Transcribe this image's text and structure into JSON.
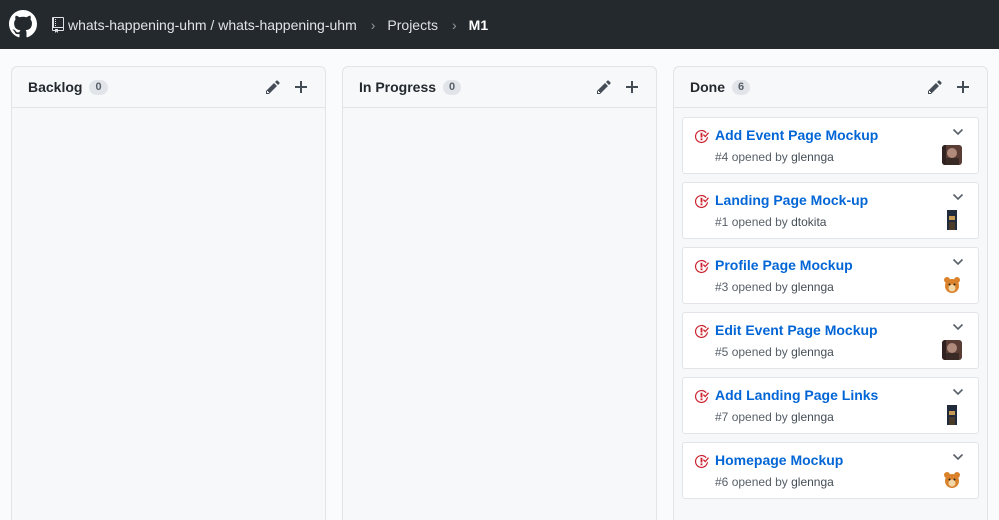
{
  "header": {
    "owner": "whats-happening-uhm",
    "separator": " / ",
    "repo": "whats-happening-uhm",
    "projects_label": "Projects",
    "project_name": "M1"
  },
  "columns": [
    {
      "name": "Backlog",
      "count": "0",
      "cards": []
    },
    {
      "name": "In Progress",
      "count": "0",
      "cards": []
    },
    {
      "name": "Done",
      "count": "6",
      "cards": [
        {
          "title": "Add Event Page Mockup",
          "number": "#4",
          "opened_by": "opened by",
          "author": "glennga",
          "avatar": "photo-dark"
        },
        {
          "title": "Landing Page Mock-up",
          "number": "#1",
          "opened_by": "opened by",
          "author": "dtokita",
          "avatar": "photo-night"
        },
        {
          "title": "Profile Page Mockup",
          "number": "#3",
          "opened_by": "opened by",
          "author": "glennga",
          "avatar": "cartoon-bear"
        },
        {
          "title": "Edit Event Page Mockup",
          "number": "#5",
          "opened_by": "opened by",
          "author": "glennga",
          "avatar": "photo-dark"
        },
        {
          "title": "Add Landing Page Links",
          "number": "#7",
          "opened_by": "opened by",
          "author": "glennga",
          "avatar": "photo-night"
        },
        {
          "title": "Homepage Mockup",
          "number": "#6",
          "opened_by": "opened by",
          "author": "glennga",
          "avatar": "cartoon-bear"
        }
      ]
    }
  ],
  "colors": {
    "header_bg": "#24292e",
    "link_blue": "#0366d6",
    "closed_issue_red": "#cb2431"
  }
}
